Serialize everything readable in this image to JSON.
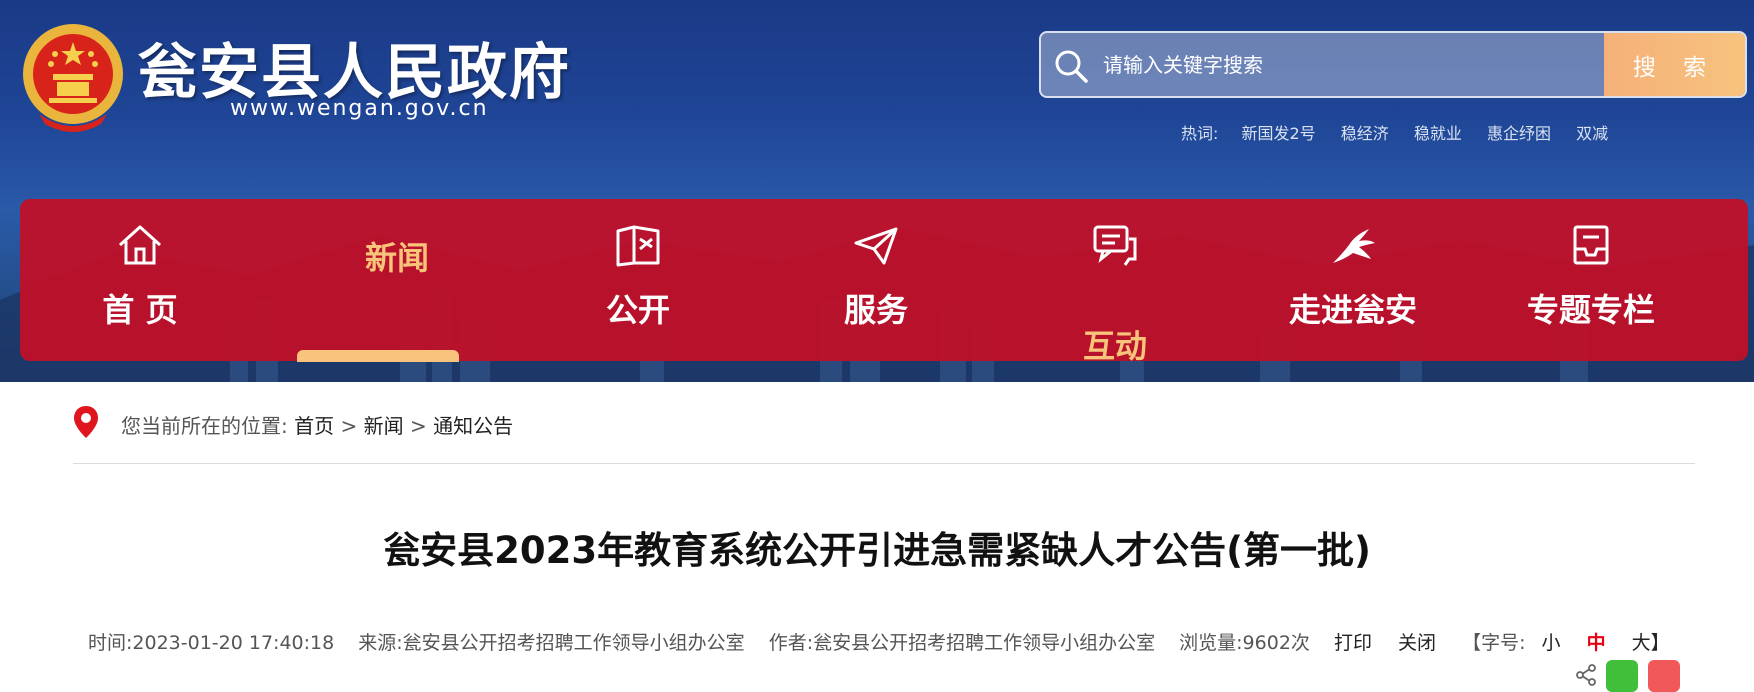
{
  "header": {
    "site_name": "瓮安县人民政府",
    "site_url": "www.wengan.gov.cn",
    "search": {
      "placeholder": "请输入关键字搜索",
      "button_label": "搜 索"
    },
    "hotwords": {
      "label": "热词:",
      "items": [
        "新国发2号",
        "稳经济",
        "稳就业",
        "惠企纾困",
        "双减"
      ]
    }
  },
  "nav": {
    "items": [
      {
        "label": "首 页",
        "icon": "home-icon"
      },
      {
        "label": "新闻",
        "icon": "none",
        "active": true
      },
      {
        "label": "公开",
        "icon": "book-icon"
      },
      {
        "label": "服务",
        "icon": "paper-plane-icon"
      },
      {
        "label": "互动",
        "icon": "chat-icon"
      },
      {
        "label": "走进瓮安",
        "icon": "dragon-icon"
      },
      {
        "label": "专题专栏",
        "icon": "inbox-icon"
      }
    ]
  },
  "breadcrumb": {
    "prefix": "您当前所在的位置:",
    "items": [
      "首页",
      "新闻",
      "通知公告"
    ],
    "separator": ">"
  },
  "article": {
    "title": "瓮安县2023年教育系统公开引进急需紧缺人才公告(第一批)",
    "meta": {
      "time": "时间:2023-01-20 17:40:18",
      "source": "来源:瓮安县公开招考招聘工作领导小组办公室",
      "author": "作者:瓮安县公开招考招聘工作领导小组办公室",
      "views": "浏览量:9602次",
      "print_label": "打印",
      "close_label": "关闭",
      "font_size_prefix": "【字号:",
      "font_small": "小",
      "font_medium": "中",
      "font_large": "大】"
    }
  },
  "colors": {
    "nav_red": "#c40e26",
    "accent_gold": "#f7c37d",
    "header_blue": "#1f4596"
  }
}
